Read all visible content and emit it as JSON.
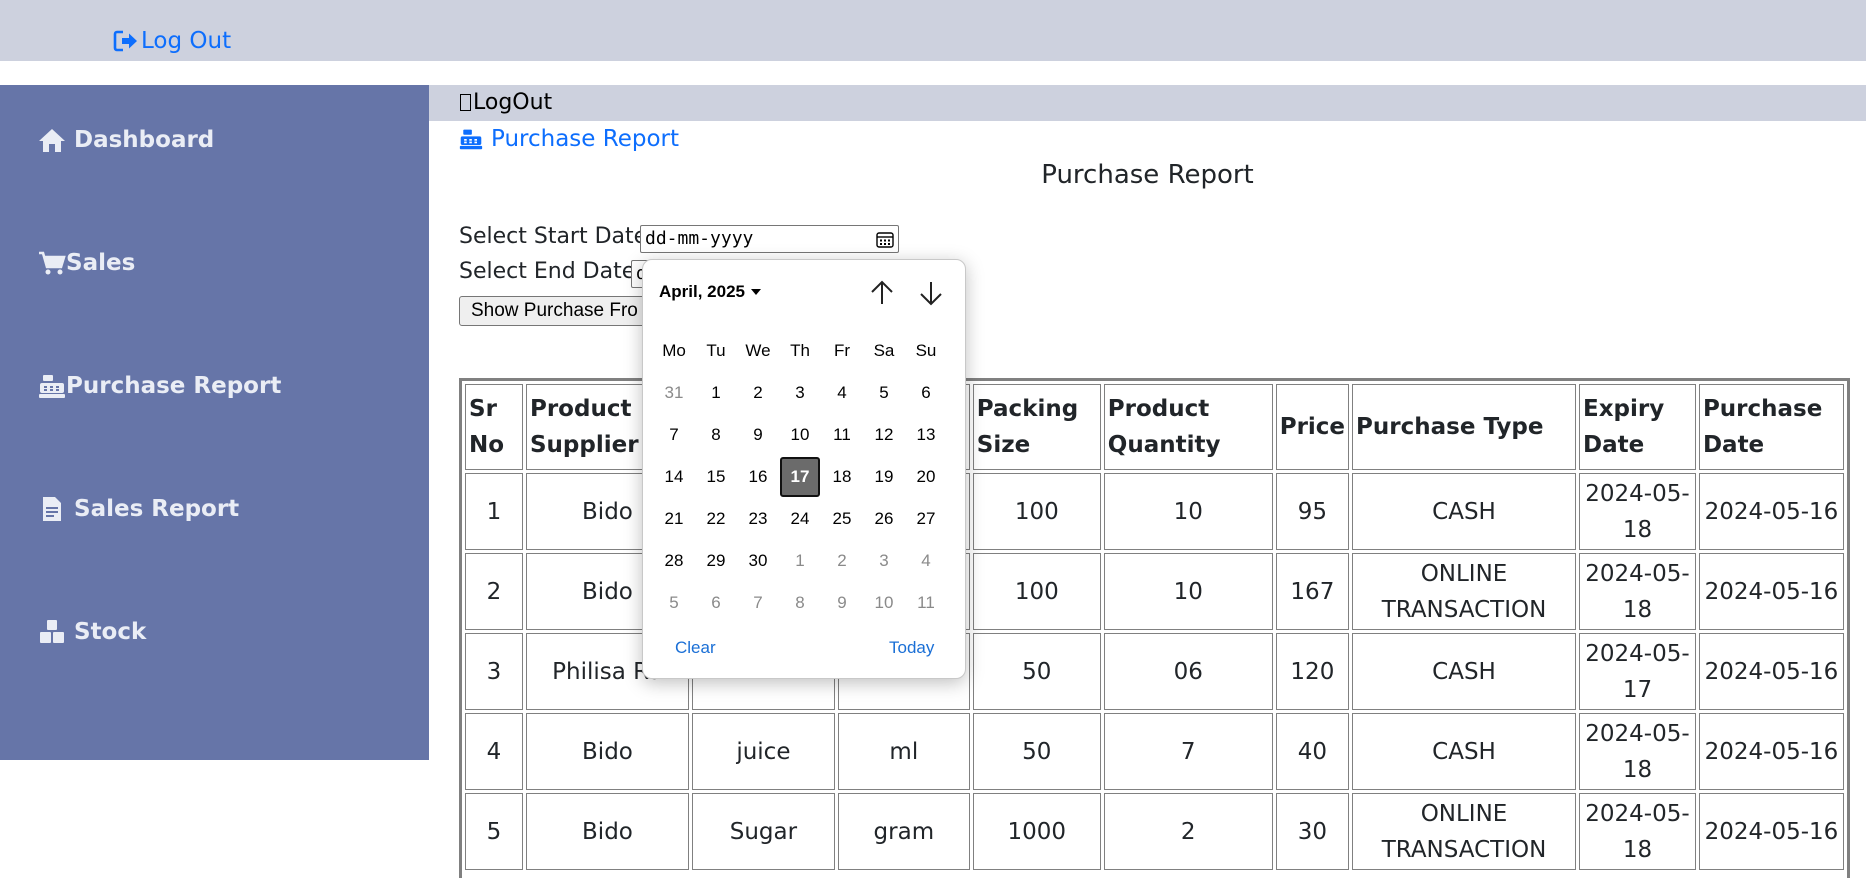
{
  "topbar": {
    "logout_label": "Log Out"
  },
  "sidebar": {
    "items": [
      {
        "label": "Dashboard",
        "icon": "home-icon"
      },
      {
        "label": "Sales",
        "icon": "cart-icon"
      },
      {
        "label": "Purchase Report",
        "icon": "cash-register-icon"
      },
      {
        "label": "Sales Report",
        "icon": "file-invoice-icon"
      },
      {
        "label": "Stock",
        "icon": "cubes-icon"
      }
    ]
  },
  "main": {
    "logout_label": "LogOut",
    "breadcrumb": "Purchase Report",
    "title": "Purchase Report",
    "start_label": "Select Start Date",
    "start_value": "dd-mm-yyyy",
    "end_label": "Select End Date",
    "end_value": "d",
    "show_button": "Show Purchase Fro"
  },
  "table": {
    "headers": [
      "Sr No",
      "Product Supplier",
      "",
      "",
      "Packing Size",
      "Product Quantity",
      "Price",
      "Purchase Type",
      "Expiry Date",
      "Purchase Date"
    ],
    "rows": [
      [
        "1",
        "Bido",
        "",
        "",
        "100",
        "10",
        "95",
        "CASH",
        "2024-05-18",
        "2024-05-16"
      ],
      [
        "2",
        "Bido",
        "",
        "",
        "100",
        "10",
        "167",
        "ONLINE TRANSACTION",
        "2024-05-18",
        "2024-05-16"
      ],
      [
        "3",
        "Philisa Ra",
        "",
        "",
        "50",
        "06",
        "120",
        "CASH",
        "2024-05-17",
        "2024-05-16"
      ],
      [
        "4",
        "Bido",
        "juice",
        "ml",
        "50",
        "7",
        "40",
        "CASH",
        "2024-05-18",
        "2024-05-16"
      ],
      [
        "5",
        "Bido",
        "Sugar",
        "gram",
        "1000",
        "2",
        "30",
        "ONLINE TRANSACTION",
        "2024-05-18",
        "2024-05-16"
      ]
    ]
  },
  "datepicker": {
    "month_label": "April, 2025",
    "weekdays": [
      "Mo",
      "Tu",
      "We",
      "Th",
      "Fr",
      "Sa",
      "Su"
    ],
    "weeks": [
      [
        "31",
        "1",
        "2",
        "3",
        "4",
        "5",
        "6"
      ],
      [
        "7",
        "8",
        "9",
        "10",
        "11",
        "12",
        "13"
      ],
      [
        "14",
        "15",
        "16",
        "17",
        "18",
        "19",
        "20"
      ],
      [
        "21",
        "22",
        "23",
        "24",
        "25",
        "26",
        "27"
      ],
      [
        "28",
        "29",
        "30",
        "1",
        "2",
        "3",
        "4"
      ],
      [
        "5",
        "6",
        "7",
        "8",
        "9",
        "10",
        "11"
      ]
    ],
    "selected_day": "17",
    "clear_label": "Clear",
    "today_label": "Today"
  },
  "colors": {
    "topbar": "#cdd1de",
    "sidebar": "#6675a8",
    "link": "#0d6efd",
    "selected_day": "#6b6b6b"
  }
}
